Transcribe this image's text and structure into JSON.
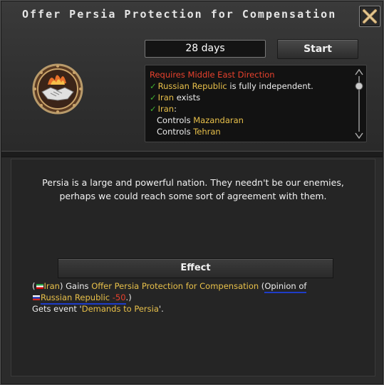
{
  "window": {
    "title": "Offer Persia Protection for Compensation",
    "close_icon": "close-x-icon"
  },
  "controls": {
    "days": "28 days",
    "start_label": "Start"
  },
  "emblem": {
    "icon": "handshake-flame-icon"
  },
  "requirements": {
    "header": "Requires Middle East Direction",
    "line1": {
      "country": "Russian Republic",
      "text": " is fully independent."
    },
    "line2": {
      "country": "Iran",
      "text": " exists"
    },
    "line3": {
      "country": "Iran",
      "text": ":"
    },
    "line4": {
      "prefix": "Controls ",
      "state": "Mazandaran"
    },
    "line5": {
      "prefix": "Controls ",
      "state": "Tehran"
    }
  },
  "description": {
    "line1": "Persia is a large and powerful nation. They needn't be our enemies,",
    "line2": "perhaps we could reach some sort of agreement with them."
  },
  "effect": {
    "title": "Effect",
    "open_paren": "(",
    "country": "Iran",
    "gains": ") Gains ",
    "gains_value": "Offer Persia Protection for Compensation",
    "paren_open2": " (",
    "opinion_label": "Opinion of",
    "opinion_country": "Russian Republic",
    "opinion_value": " -50",
    "close": ".)",
    "event_prefix": "Gets event '",
    "event_name": "Demands to Persia",
    "event_suffix": "'."
  },
  "colors": {
    "gold": "#e8c04a",
    "red": "#e8412d",
    "check": "#3fae2e",
    "underline": "#1e3cc8"
  }
}
